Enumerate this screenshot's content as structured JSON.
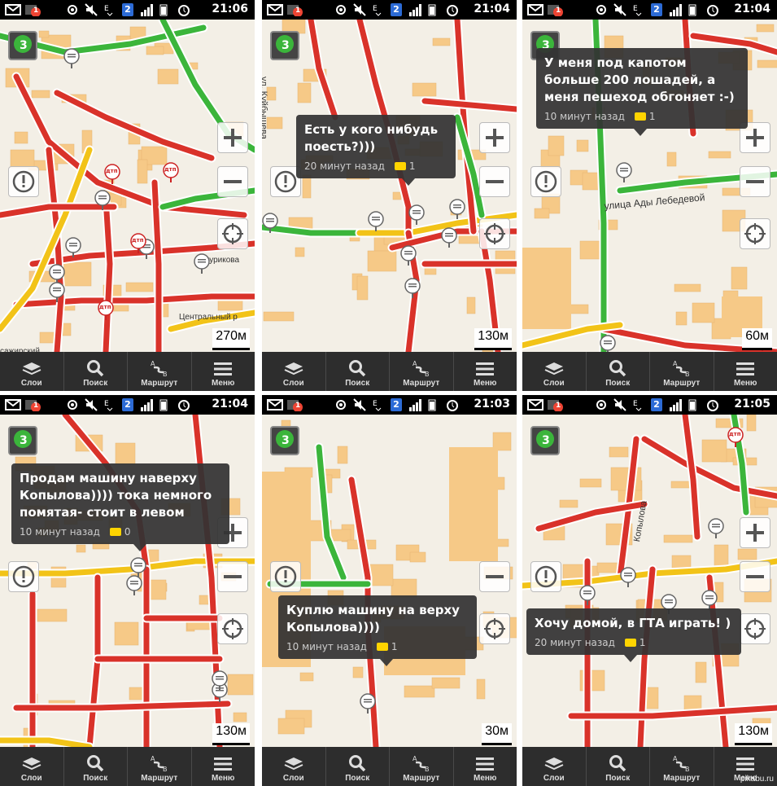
{
  "panels": [
    {
      "time": "21:06",
      "notif": "1",
      "sim": "2",
      "scale": "270м",
      "bubble": null
    },
    {
      "time": "21:04",
      "notif": "1",
      "sim": "2",
      "scale": "130м",
      "bubble": {
        "text": "Есть у кого нибудь\nпоесть?)))",
        "age": "20 минут назад",
        "comments": "1"
      }
    },
    {
      "time": "21:04",
      "notif": "1",
      "sim": "2",
      "scale": "60м",
      "bubble": {
        "text": "У меня под капотом\nбольше 200 лошадей, а\nменя пешеход обгоняет :-)",
        "age": "10 минут назад",
        "comments": "1"
      }
    },
    {
      "time": "21:04",
      "notif": "1",
      "sim": "2",
      "scale": "130м",
      "bubble": {
        "text": "Продам машину наверху\nКопылова)))) тока немного\nпомятая- стоит в левом",
        "age": "10 минут назад",
        "comments": "0"
      }
    },
    {
      "time": "21:03",
      "notif": "1",
      "sim": "2",
      "scale": "30м",
      "bubble": {
        "text": "Куплю машину на верху\nКопылова))))",
        "age": "10 минут назад",
        "comments": "1"
      }
    },
    {
      "time": "21:05",
      "notif": "1",
      "sim": "2",
      "scale": "130м",
      "bubble": {
        "text": "Хочу домой, в ГТА играть! )",
        "age": "20 минут назад",
        "comments": "1"
      }
    }
  ],
  "traffic_level": "3",
  "toolbar": {
    "layers": "Слои",
    "search": "Поиск",
    "route": "Маршрут",
    "menu": "Меню"
  },
  "map_labels": {
    "street_kuybysheva": "ул. Куйбышева",
    "street_ady_lebedevoy": "улица Ады Лебедевой",
    "street_kopylova": "Копылова",
    "street_surikova": "Сурикова",
    "central_market": "Центральный р",
    "vzhirskiy": "сажирский",
    "dtp": "дтп"
  },
  "colors": {
    "jam": "#d9322a",
    "slow": "#f2c318",
    "free": "#3bb53b",
    "road": "#ffffff",
    "building": "#f6c987",
    "land": "#f3efe6"
  },
  "watermark": "pikabu.ru"
}
